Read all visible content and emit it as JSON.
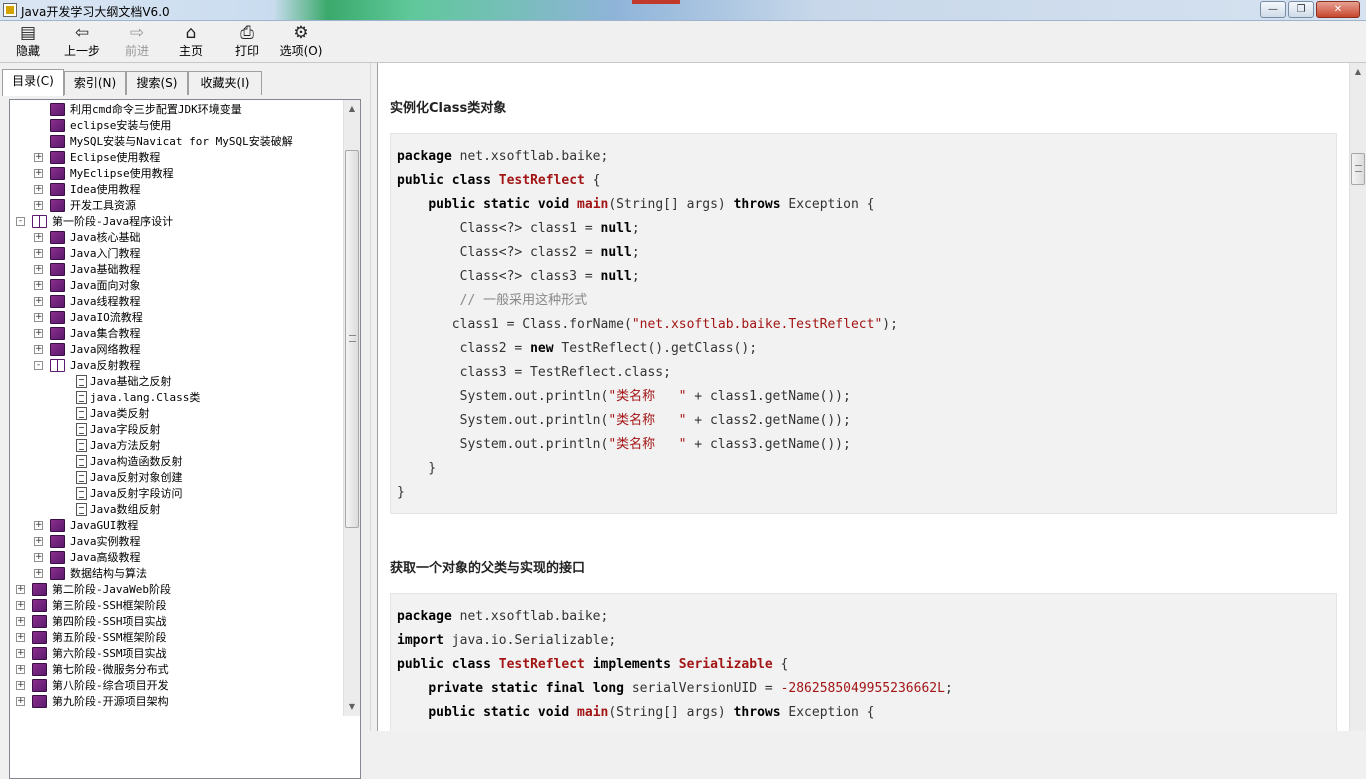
{
  "window": {
    "title": "Java开发学习大纲文档V6.0",
    "min_glyph": "—",
    "max_glyph": "❐",
    "close_glyph": "✕"
  },
  "toolbar": {
    "hide": "隐藏",
    "back": "上一步",
    "forward": "前进",
    "home": "主页",
    "print": "打印",
    "options": "选项(O)"
  },
  "tabs": {
    "contents": "目录(C)",
    "index": "索引(N)",
    "search": "搜索(S)",
    "favorites": "收藏夹(I)"
  },
  "tree": [
    {
      "level": 2,
      "icon": "book",
      "expander": "",
      "label": "利用cmd命令三步配置JDK环境变量"
    },
    {
      "level": 2,
      "icon": "book",
      "expander": "",
      "label": "eclipse安装与使用"
    },
    {
      "level": 2,
      "icon": "book",
      "expander": "",
      "label": "MySQL安装与Navicat for MySQL安装破解"
    },
    {
      "level": 2,
      "icon": "book",
      "expander": "+",
      "label": "Eclipse使用教程"
    },
    {
      "level": 2,
      "icon": "book",
      "expander": "+",
      "label": "MyEclipse使用教程"
    },
    {
      "level": 2,
      "icon": "book",
      "expander": "+",
      "label": "Idea使用教程"
    },
    {
      "level": 2,
      "icon": "book",
      "expander": "+",
      "label": "开发工具资源"
    },
    {
      "level": 1,
      "icon": "book-open",
      "expander": "-",
      "label": "第一阶段-Java程序设计"
    },
    {
      "level": 2,
      "icon": "book",
      "expander": "+",
      "label": "Java核心基础"
    },
    {
      "level": 2,
      "icon": "book",
      "expander": "+",
      "label": "Java入门教程"
    },
    {
      "level": 2,
      "icon": "book",
      "expander": "+",
      "label": "Java基础教程"
    },
    {
      "level": 2,
      "icon": "book",
      "expander": "+",
      "label": "Java面向对象"
    },
    {
      "level": 2,
      "icon": "book",
      "expander": "+",
      "label": "Java线程教程"
    },
    {
      "level": 2,
      "icon": "book",
      "expander": "+",
      "label": "JavaIO流教程"
    },
    {
      "level": 2,
      "icon": "book",
      "expander": "+",
      "label": "Java集合教程"
    },
    {
      "level": 2,
      "icon": "book",
      "expander": "+",
      "label": "Java网络教程"
    },
    {
      "level": 2,
      "icon": "book-open",
      "expander": "-",
      "label": "Java反射教程"
    },
    {
      "level": 3,
      "icon": "page",
      "expander": "",
      "label": "Java基础之反射"
    },
    {
      "level": 3,
      "icon": "page",
      "expander": "",
      "label": "java.lang.Class类"
    },
    {
      "level": 3,
      "icon": "page",
      "expander": "",
      "label": "Java类反射"
    },
    {
      "level": 3,
      "icon": "page",
      "expander": "",
      "label": "Java字段反射"
    },
    {
      "level": 3,
      "icon": "page",
      "expander": "",
      "label": "Java方法反射"
    },
    {
      "level": 3,
      "icon": "page",
      "expander": "",
      "label": "Java构造函数反射"
    },
    {
      "level": 3,
      "icon": "page",
      "expander": "",
      "label": "Java反射对象创建"
    },
    {
      "level": 3,
      "icon": "page",
      "expander": "",
      "label": "Java反射字段访问"
    },
    {
      "level": 3,
      "icon": "page",
      "expander": "",
      "label": "Java数组反射"
    },
    {
      "level": 2,
      "icon": "book",
      "expander": "+",
      "label": "JavaGUI教程"
    },
    {
      "level": 2,
      "icon": "book",
      "expander": "+",
      "label": "Java实例教程"
    },
    {
      "level": 2,
      "icon": "book",
      "expander": "+",
      "label": "Java高级教程"
    },
    {
      "level": 2,
      "icon": "book",
      "expander": "+",
      "label": "数据结构与算法"
    },
    {
      "level": 1,
      "icon": "book",
      "expander": "+",
      "label": "第二阶段-JavaWeb阶段"
    },
    {
      "level": 1,
      "icon": "book",
      "expander": "+",
      "label": "第三阶段-SSH框架阶段"
    },
    {
      "level": 1,
      "icon": "book",
      "expander": "+",
      "label": "第四阶段-SSH项目实战"
    },
    {
      "level": 1,
      "icon": "book",
      "expander": "+",
      "label": "第五阶段-SSM框架阶段"
    },
    {
      "level": 1,
      "icon": "book",
      "expander": "+",
      "label": "第六阶段-SSM项目实战"
    },
    {
      "level": 1,
      "icon": "book",
      "expander": "+",
      "label": "第七阶段-微服务分布式"
    },
    {
      "level": 1,
      "icon": "book",
      "expander": "+",
      "label": "第八阶段-综合项目开发"
    },
    {
      "level": 1,
      "icon": "book",
      "expander": "+",
      "label": "第九阶段-开源项目架构"
    }
  ],
  "content": {
    "section1_title": "实例化Class类对象",
    "section1_code": [
      [
        {
          "t": "package",
          "c": "kw"
        },
        {
          "t": " net.xsoftlab.baike;"
        }
      ],
      [
        {
          "t": "public",
          "c": "kw"
        },
        {
          "t": " "
        },
        {
          "t": "class",
          "c": "kw"
        },
        {
          "t": " "
        },
        {
          "t": "TestReflect",
          "c": "cls"
        },
        {
          "t": " {"
        }
      ],
      [
        {
          "t": "    "
        },
        {
          "t": "public",
          "c": "kw"
        },
        {
          "t": " "
        },
        {
          "t": "static",
          "c": "kw"
        },
        {
          "t": " "
        },
        {
          "t": "void",
          "c": "kw"
        },
        {
          "t": " "
        },
        {
          "t": "main",
          "c": "cls"
        },
        {
          "t": "(String[] args) "
        },
        {
          "t": "throws",
          "c": "kw"
        },
        {
          "t": " Exception {"
        }
      ],
      [
        {
          "t": "        Class<?> class1 = "
        },
        {
          "t": "null",
          "c": "kw"
        },
        {
          "t": ";"
        }
      ],
      [
        {
          "t": "        Class<?> class2 = "
        },
        {
          "t": "null",
          "c": "kw"
        },
        {
          "t": ";"
        }
      ],
      [
        {
          "t": "        Class<?> class3 = "
        },
        {
          "t": "null",
          "c": "kw"
        },
        {
          "t": ";"
        }
      ],
      [
        {
          "t": "        // 一般采用这种形式",
          "c": "cmt"
        }
      ],
      [
        {
          "t": "       class1 = Class.forName("
        },
        {
          "t": "\"net.xsoftlab.baike.TestReflect\"",
          "c": "str"
        },
        {
          "t": ");"
        }
      ],
      [
        {
          "t": "        class2 = "
        },
        {
          "t": "new",
          "c": "kw"
        },
        {
          "t": " TestReflect().getClass();"
        }
      ],
      [
        {
          "t": "        class3 = TestReflect.class;"
        }
      ],
      [
        {
          "t": "        System.out.println("
        },
        {
          "t": "\"类名称   \"",
          "c": "str"
        },
        {
          "t": " + class1.getName());"
        }
      ],
      [
        {
          "t": "        System.out.println("
        },
        {
          "t": "\"类名称   \"",
          "c": "str"
        },
        {
          "t": " + class2.getName());"
        }
      ],
      [
        {
          "t": "        System.out.println("
        },
        {
          "t": "\"类名称   \"",
          "c": "str"
        },
        {
          "t": " + class3.getName());"
        }
      ],
      [
        {
          "t": "    }"
        }
      ],
      [
        {
          "t": "}"
        }
      ]
    ],
    "section2_title": "获取一个对象的父类与实现的接口",
    "section2_code": [
      [
        {
          "t": "package",
          "c": "kw"
        },
        {
          "t": " net.xsoftlab.baike;"
        }
      ],
      [
        {
          "t": "import",
          "c": "kw"
        },
        {
          "t": " java.io.Serializable;"
        }
      ],
      [
        {
          "t": "public",
          "c": "kw"
        },
        {
          "t": " "
        },
        {
          "t": "class",
          "c": "kw"
        },
        {
          "t": " "
        },
        {
          "t": "TestReflect",
          "c": "cls"
        },
        {
          "t": " "
        },
        {
          "t": "implements",
          "c": "kw"
        },
        {
          "t": " "
        },
        {
          "t": "Serializable",
          "c": "cls"
        },
        {
          "t": " {"
        }
      ],
      [
        {
          "t": "    "
        },
        {
          "t": "private",
          "c": "kw"
        },
        {
          "t": " "
        },
        {
          "t": "static",
          "c": "kw"
        },
        {
          "t": " "
        },
        {
          "t": "final",
          "c": "kw"
        },
        {
          "t": " "
        },
        {
          "t": "long",
          "c": "kw"
        },
        {
          "t": " serialVersionUID = "
        },
        {
          "t": "-2862585049955236662L",
          "c": "num"
        },
        {
          "t": ";"
        }
      ],
      [
        {
          "t": "    "
        },
        {
          "t": "public",
          "c": "kw"
        },
        {
          "t": " "
        },
        {
          "t": "static",
          "c": "kw"
        },
        {
          "t": " "
        },
        {
          "t": "void",
          "c": "kw"
        },
        {
          "t": " "
        },
        {
          "t": "main",
          "c": "cls"
        },
        {
          "t": "(String[] args) "
        },
        {
          "t": "throws",
          "c": "kw"
        },
        {
          "t": " Exception {"
        }
      ]
    ]
  },
  "scrollbars": {
    "up_glyph": "▲",
    "down_glyph": "▼"
  }
}
